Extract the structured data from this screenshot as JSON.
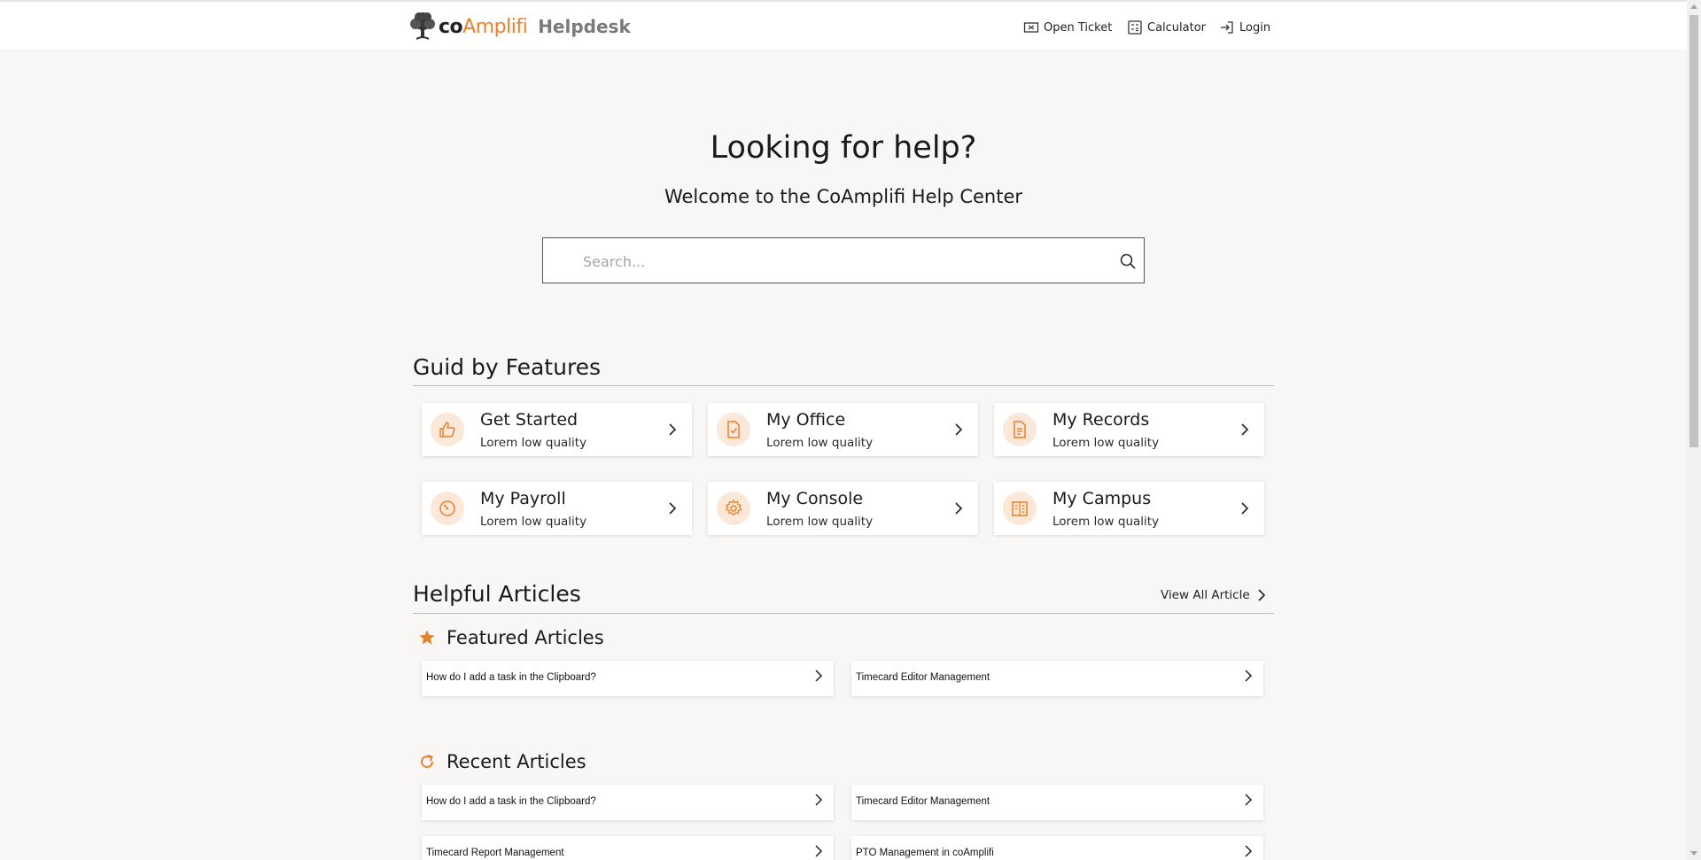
{
  "header": {
    "logo_co": "co",
    "logo_amp": "Amplifi",
    "logo_helpdesk": "Helpdesk",
    "nav": {
      "open_ticket": "Open Ticket",
      "calculator": "Calculator",
      "login": "Login"
    }
  },
  "hero": {
    "title": "Looking for help?",
    "subtitle": "Welcome to the CoAmplifi Help Center",
    "search_placeholder": "Search..."
  },
  "features": {
    "title": "Guid by Features",
    "cards": [
      {
        "title": "Get Started",
        "sub": "Lorem low quality",
        "icon": "thumbs-up-icon"
      },
      {
        "title": "My Office",
        "sub": "Lorem low quality",
        "icon": "document-check-icon"
      },
      {
        "title": "My Records",
        "sub": "Lorem low quality",
        "icon": "document-lines-icon"
      },
      {
        "title": "My Payroll",
        "sub": "Lorem low quality",
        "icon": "gauge-icon"
      },
      {
        "title": "My Console",
        "sub": "Lorem low quality",
        "icon": "gear-icon"
      },
      {
        "title": "My Campus",
        "sub": "Lorem low quality",
        "icon": "building-icon"
      }
    ]
  },
  "articles": {
    "title": "Helpful Articles",
    "view_all": "View All Article",
    "featured_title": "Featured Articles",
    "featured": [
      "How do I add a task in the Clipboard?",
      "Timecard Editor Management"
    ],
    "recent_title": "Recent Articles",
    "recent": [
      "How do I add a task in the Clipboard?",
      "Timecard Editor Management",
      "Timecard Report Management",
      "PTO Management in coAmplifi"
    ]
  },
  "colors": {
    "accent": "#e8812b",
    "icon_bg": "#fbe8d8",
    "page_bg": "#f8f7f5"
  }
}
